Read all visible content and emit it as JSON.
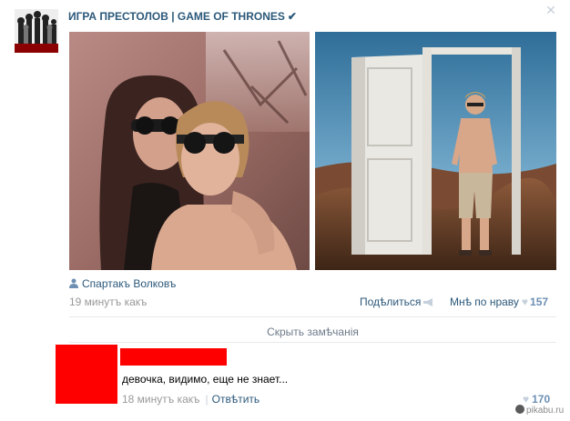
{
  "post": {
    "group_title": "ИГРА ПРЕСТОЛОВ | GAME OF THRONES",
    "verified_mark": "✔",
    "close_symbol": "✕",
    "author_name": "Спартакъ Волковъ",
    "time": "19 минутъ какъ",
    "share_label": "Подѣлиться",
    "like_label": "Мнѣ по нраву",
    "like_count": "157"
  },
  "comments_section": {
    "hide_label": "Скрыть замѣчанія"
  },
  "comment": {
    "text": "девочка, видимо, еще не знает...",
    "time": "18 минутъ какъ",
    "separator": "|",
    "reply_label": "Отвѣтить",
    "like_count": "170"
  },
  "watermark": {
    "text": "pikabu.ru"
  },
  "colors": {
    "link": "#2b587a",
    "muted": "#999999",
    "censor_red": "#ff0000"
  },
  "icons": {
    "verified": "checkmark-icon",
    "close": "close-icon",
    "author": "user-icon",
    "share": "megaphone-icon",
    "like": "heart-icon"
  }
}
